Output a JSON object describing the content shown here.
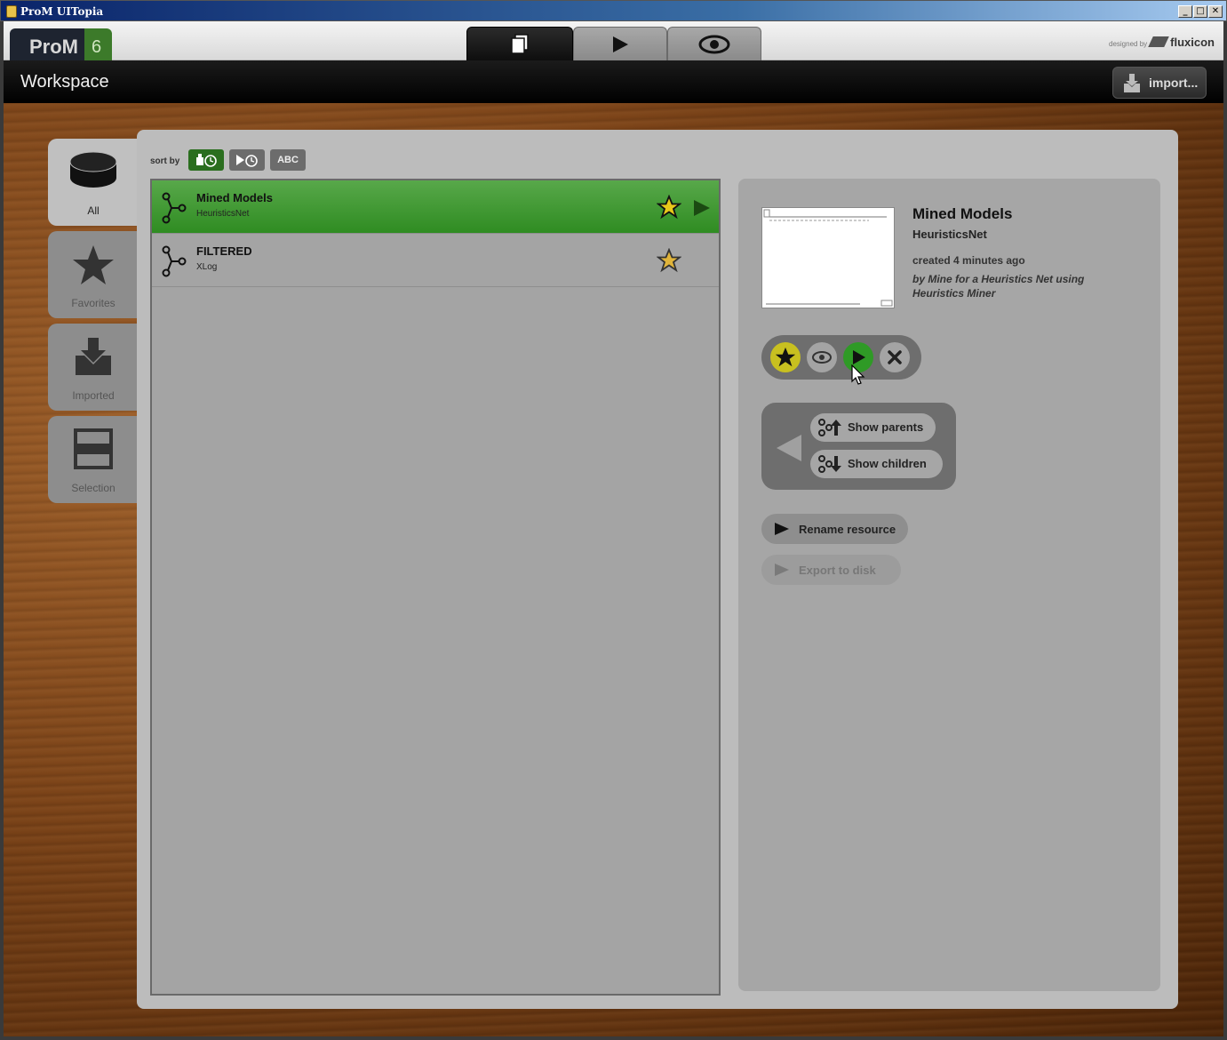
{
  "window": {
    "title": "ProM UITopia",
    "buttons": [
      "_",
      "□",
      "✕"
    ]
  },
  "header": {
    "logo_text": "ProM",
    "logo_version": "6",
    "designed_by": "designed by",
    "brand": "fluxicon",
    "tabs": [
      {
        "name": "workspace",
        "icon": "pages-icon",
        "active": true
      },
      {
        "name": "actions",
        "icon": "play-icon",
        "active": false
      },
      {
        "name": "views",
        "icon": "eye-icon",
        "active": false
      }
    ]
  },
  "workspace_bar": {
    "title": "Workspace",
    "import_label": "import..."
  },
  "categories": [
    {
      "label": "All",
      "icon": "database-icon",
      "active": true
    },
    {
      "label": "Favorites",
      "icon": "star-icon",
      "active": false
    },
    {
      "label": "Imported",
      "icon": "import-icon",
      "active": false
    },
    {
      "label": "Selection",
      "icon": "selection-icon",
      "active": false
    }
  ],
  "sort": {
    "label": "sort by",
    "options": [
      {
        "label": "created-time",
        "icon": "creation-clock-icon",
        "active": true
      },
      {
        "label": "run-time",
        "icon": "play-clock-icon",
        "active": false
      },
      {
        "label": "ABC",
        "icon": "",
        "active": false
      }
    ]
  },
  "resources": [
    {
      "name": "Mined Models",
      "type": "HeuristicsNet",
      "favorite": true,
      "selected": true
    },
    {
      "name": "FILTERED",
      "type": "XLog",
      "favorite": true,
      "selected": false
    }
  ],
  "detail": {
    "name": "Mined Models",
    "type": "HeuristicsNet",
    "created": "created 4 minutes ago",
    "by": "by Mine for a Heuristics Net using Heuristics Miner",
    "actions": [
      "favorite-icon",
      "view-icon",
      "play-icon",
      "remove-icon"
    ],
    "show_parents": "Show parents",
    "show_children": "Show children",
    "rename": "Rename resource",
    "export": "Export to disk"
  },
  "colors": {
    "selected_row": "#3f9a33",
    "accent_green": "#2a6e1e",
    "star": "#e8c81a"
  }
}
